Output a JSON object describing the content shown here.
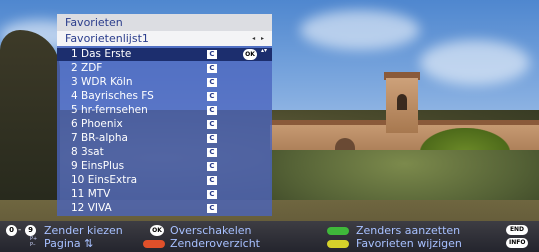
{
  "menu": {
    "title": "Favorieten",
    "list_name": "Favorietenlijst1",
    "list_arrows": "◂ ▸",
    "channels": [
      {
        "label": "1 Das Erste",
        "badge": "C",
        "selected": true
      },
      {
        "label": "2 ZDF",
        "badge": "C",
        "selected": false
      },
      {
        "label": "3 WDR Köln",
        "badge": "C",
        "selected": false
      },
      {
        "label": "4 Bayrisches FS",
        "badge": "C",
        "selected": false
      },
      {
        "label": "5 hr-fernsehen",
        "badge": "C",
        "selected": false
      },
      {
        "label": "6 Phoenix",
        "badge": "C",
        "selected": false
      },
      {
        "label": "7 BR-alpha",
        "badge": "C",
        "selected": false
      },
      {
        "label": "8 3sat",
        "badge": "C",
        "selected": false
      },
      {
        "label": "9 EinsPlus",
        "badge": "C",
        "selected": false
      },
      {
        "label": "10 EinsExtra",
        "badge": "C",
        "selected": false
      },
      {
        "label": "11 MTV",
        "badge": "C",
        "selected": false
      },
      {
        "label": "12 VIVA",
        "badge": "C",
        "selected": false
      }
    ],
    "ok_key": "OK",
    "scroll_arrows": "▴▾"
  },
  "helpbar": {
    "key_0": "0",
    "key_dash": "-",
    "key_9": "9",
    "zender_kiezen": "Zender kiezen",
    "pagina_key_top": "P+",
    "pagina_key_bottom": "P–",
    "pagina": "Pagina ⇅",
    "ok_key": "OK",
    "overschakelen": "Overschakelen",
    "zenderoverzicht": "Zenderoverzicht",
    "zenders_aanzetten": "Zenders aanzetten",
    "favorieten_wijzigen": "Favorieten wijzigen",
    "end_key": "END",
    "info_key": "INFO",
    "colors": {
      "red": "#e0502a",
      "green": "#3fb83a",
      "yellow": "#d6d22a"
    }
  }
}
